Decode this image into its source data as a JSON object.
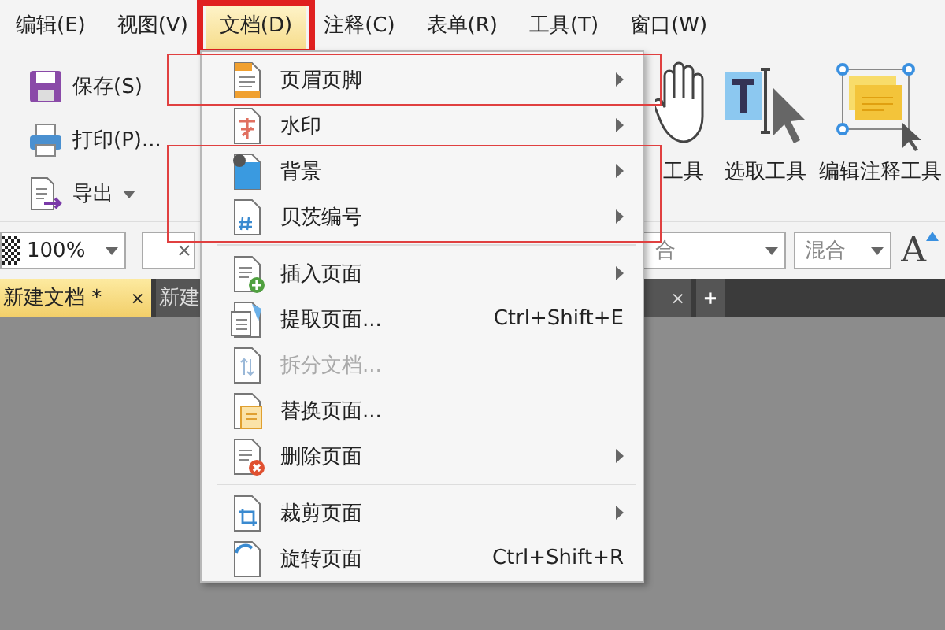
{
  "menubar": [
    {
      "label": "编辑(E)",
      "selected": false,
      "highlighted": false
    },
    {
      "label": "视图(V)",
      "selected": false,
      "highlighted": false
    },
    {
      "label": "文档(D)",
      "selected": true,
      "highlighted": true
    },
    {
      "label": "注释(C)",
      "selected": false,
      "highlighted": false
    },
    {
      "label": "表单(R)",
      "selected": false,
      "highlighted": false
    },
    {
      "label": "工具(T)",
      "selected": false,
      "highlighted": false
    },
    {
      "label": "窗口(W)",
      "selected": false,
      "highlighted": false
    }
  ],
  "toolbar": {
    "left_buttons": [
      {
        "label": "保存(S)",
        "has_dropdown": false
      },
      {
        "label": "打印(P)...",
        "has_dropdown": false
      },
      {
        "label": "导出",
        "has_dropdown": true
      }
    ],
    "tools": [
      {
        "label": "工具"
      },
      {
        "label": "选取工具"
      },
      {
        "label": "编辑注释工具"
      }
    ],
    "zoom": {
      "value": "100%"
    },
    "blend_partial": {
      "value": "合"
    },
    "blend": {
      "value": "混合"
    },
    "font_size_button": {
      "label": "A"
    }
  },
  "tabs": [
    {
      "label": "新建文档 *",
      "selected": true,
      "close": "×"
    },
    {
      "label": "新建",
      "selected": false,
      "close": "×"
    }
  ],
  "new_tab": "+",
  "document_menu": {
    "groups": [
      {
        "highlighted": true,
        "divider_before": false,
        "items": [
          {
            "label": "页眉页脚",
            "has_submenu": true,
            "disabled": false
          }
        ]
      },
      {
        "highlighted": false,
        "divider_before": false,
        "items": [
          {
            "label": "水印",
            "has_submenu": true,
            "disabled": false
          }
        ]
      },
      {
        "highlighted": true,
        "divider_before": false,
        "items": [
          {
            "label": "背景",
            "has_submenu": true,
            "disabled": false
          },
          {
            "label": "贝茨编号",
            "has_submenu": true,
            "disabled": false
          }
        ]
      },
      {
        "highlighted": false,
        "divider_before": true,
        "items": [
          {
            "label": "插入页面",
            "has_submenu": true,
            "disabled": false
          },
          {
            "label": "提取页面...",
            "shortcut": "Ctrl+Shift+E",
            "has_submenu": false,
            "disabled": false
          },
          {
            "label": "拆分文档...",
            "has_submenu": false,
            "disabled": true
          },
          {
            "label": "替换页面...",
            "has_submenu": false,
            "disabled": false
          },
          {
            "label": "删除页面",
            "has_submenu": true,
            "disabled": false
          }
        ]
      },
      {
        "highlighted": false,
        "divider_before": true,
        "items": [
          {
            "label": "裁剪页面",
            "has_submenu": true,
            "disabled": false
          },
          {
            "label": "旋转页面",
            "shortcut": "Ctrl+Shift+R",
            "has_submenu": false,
            "disabled": false
          }
        ]
      }
    ]
  }
}
